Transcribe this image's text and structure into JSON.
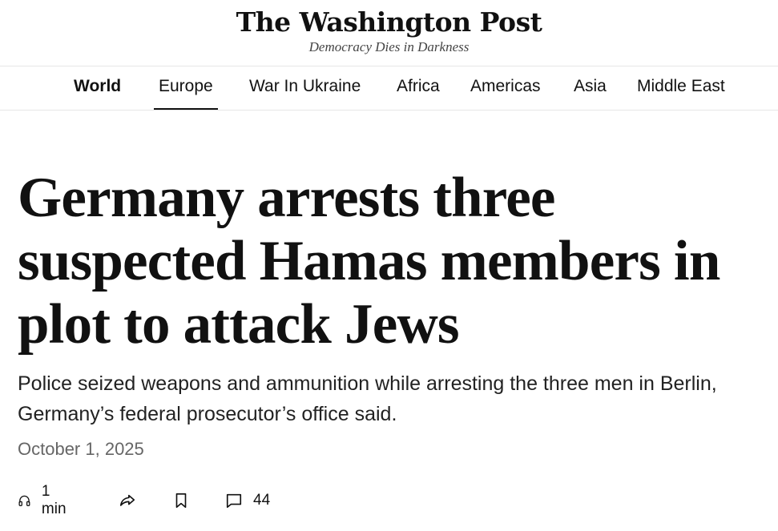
{
  "masthead": {
    "logo": "The Washington Post",
    "tagline": "Democracy Dies in Darkness"
  },
  "nav": {
    "items": [
      {
        "label": "World"
      },
      {
        "label": "Europe"
      },
      {
        "label": "War In Ukraine"
      },
      {
        "label": "Africa"
      },
      {
        "label": "Americas"
      },
      {
        "label": "Asia"
      },
      {
        "label": "Middle East"
      }
    ],
    "active": "Europe"
  },
  "article": {
    "headline": "Germany arrests three suspected Hamas members in plot to attack Jews",
    "dek": "Police seized weapons and ammunition while arresting the three men in Berlin, Germany’s federal prosecutor’s office said.",
    "date": "October 1, 2025"
  },
  "actions": {
    "listen_label": "1 min",
    "comments_count": "44",
    "icons": [
      "headphones-icon",
      "share-icon",
      "bookmark-icon",
      "comment-icon"
    ]
  }
}
